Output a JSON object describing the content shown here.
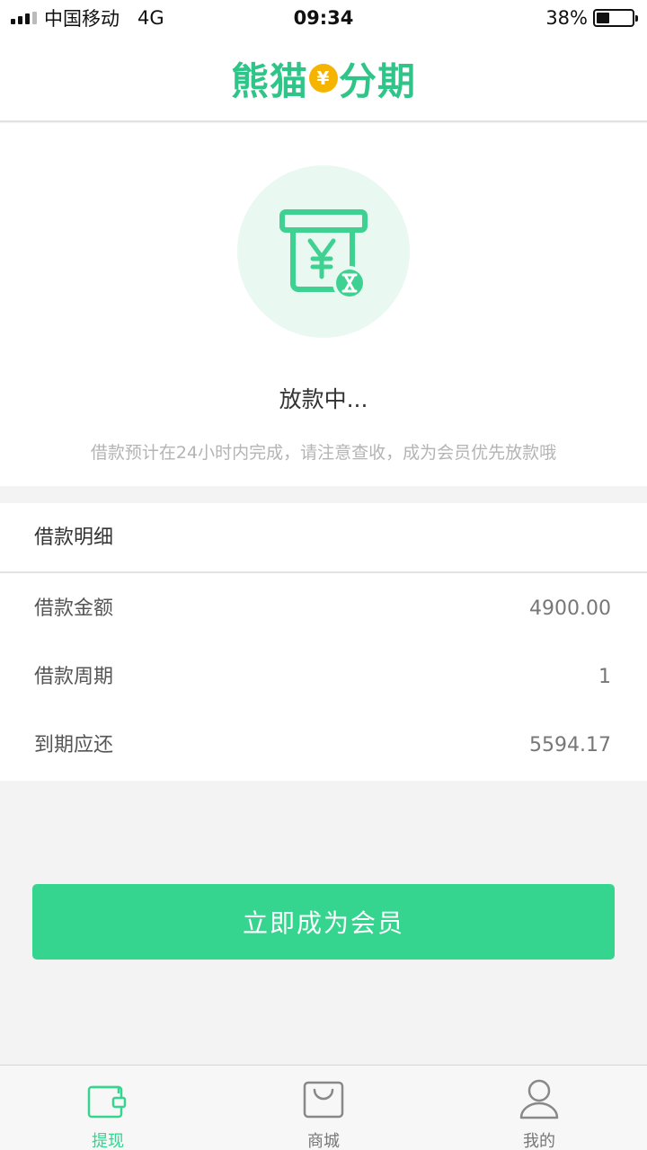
{
  "status_bar": {
    "carrier": "中国移动",
    "network": "4G",
    "time": "09:34",
    "battery_percent": "38%",
    "battery_level": 0.38
  },
  "header": {
    "logo_text": [
      "熊",
      "猫",
      "分期"
    ],
    "logo_coin": "¥"
  },
  "status": {
    "icon": "atm-cash-pending-icon",
    "title": "放款中...",
    "description": "借款预计在24小时内完成，请注意查收，成为会员优先放款哦"
  },
  "details": {
    "header": "借款明细",
    "rows": [
      {
        "label": "借款金额",
        "value": "4900.00"
      },
      {
        "label": "借款周期",
        "value": "1"
      },
      {
        "label": "到期应还",
        "value": "5594.17"
      }
    ]
  },
  "cta": {
    "label": "立即成为会员"
  },
  "tabs": [
    {
      "label": "提现",
      "icon": "wallet-icon",
      "active": true
    },
    {
      "label": "商城",
      "icon": "shopping-bag-icon",
      "active": false
    },
    {
      "label": "我的",
      "icon": "user-icon",
      "active": false
    }
  ],
  "colors": {
    "accent": "#36d58f",
    "icon_circle": "#e9f9f1",
    "coin": "#f4b400"
  }
}
